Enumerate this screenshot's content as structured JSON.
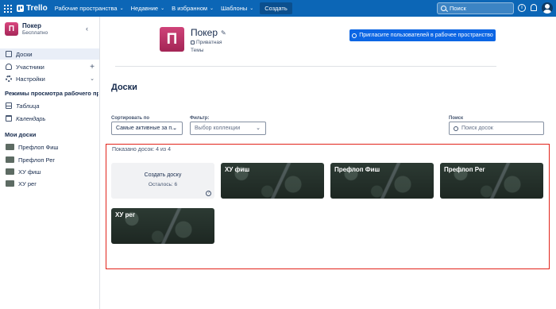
{
  "topbar": {
    "logo": "Trello",
    "nav": [
      {
        "label": "Рабочие пространства"
      },
      {
        "label": "Недавние"
      },
      {
        "label": "В избранном"
      },
      {
        "label": "Шаблоны"
      }
    ],
    "create_label": "Создать",
    "search_placeholder": "Поиск",
    "bg_color": "#0c66b6"
  },
  "sidebar": {
    "workspace_initial": "П",
    "workspace_name": "Покер",
    "workspace_plan": "Бесплатно",
    "items": [
      {
        "label": "Доски"
      },
      {
        "label": "Участники"
      },
      {
        "label": "Настройки"
      }
    ],
    "views_title": "Режимы просмотра рабочего прос...",
    "views": [
      {
        "label": "Таблица"
      },
      {
        "label": "Календарь"
      }
    ],
    "my_boards_title": "Мои доски",
    "boards": [
      {
        "label": "Префлоп Фиш"
      },
      {
        "label": "Префлоп Рег"
      },
      {
        "label": "ХУ фиш"
      },
      {
        "label": "ХУ рег"
      }
    ]
  },
  "header": {
    "initial": "П",
    "title": "Покер",
    "privacy": "Приватная",
    "topics": "Темы",
    "invite_label": "Пригласите пользователей в рабочее пространство"
  },
  "boards_section": {
    "title": "Доски",
    "sort_label": "Сортировать по",
    "sort_value": "Самые активные за п...",
    "filter_label": "Фильтр:",
    "filter_placeholder": "Выбор коллекции",
    "search_label": "Поиск",
    "search_placeholder": "Поиск досок",
    "count_text": "Показано досок: 4 из 4",
    "create_title": "Создать доску",
    "create_remaining": "Осталось: 6",
    "boards": [
      {
        "name": "ХУ фиш"
      },
      {
        "name": "Префлоп Фиш"
      },
      {
        "name": "Префлоп Рег"
      },
      {
        "name": "ХУ рег"
      }
    ]
  },
  "colors": {
    "accent": "#0c66e4",
    "highlight": "#e2231a",
    "workspace_badge": "#c13a6e"
  }
}
